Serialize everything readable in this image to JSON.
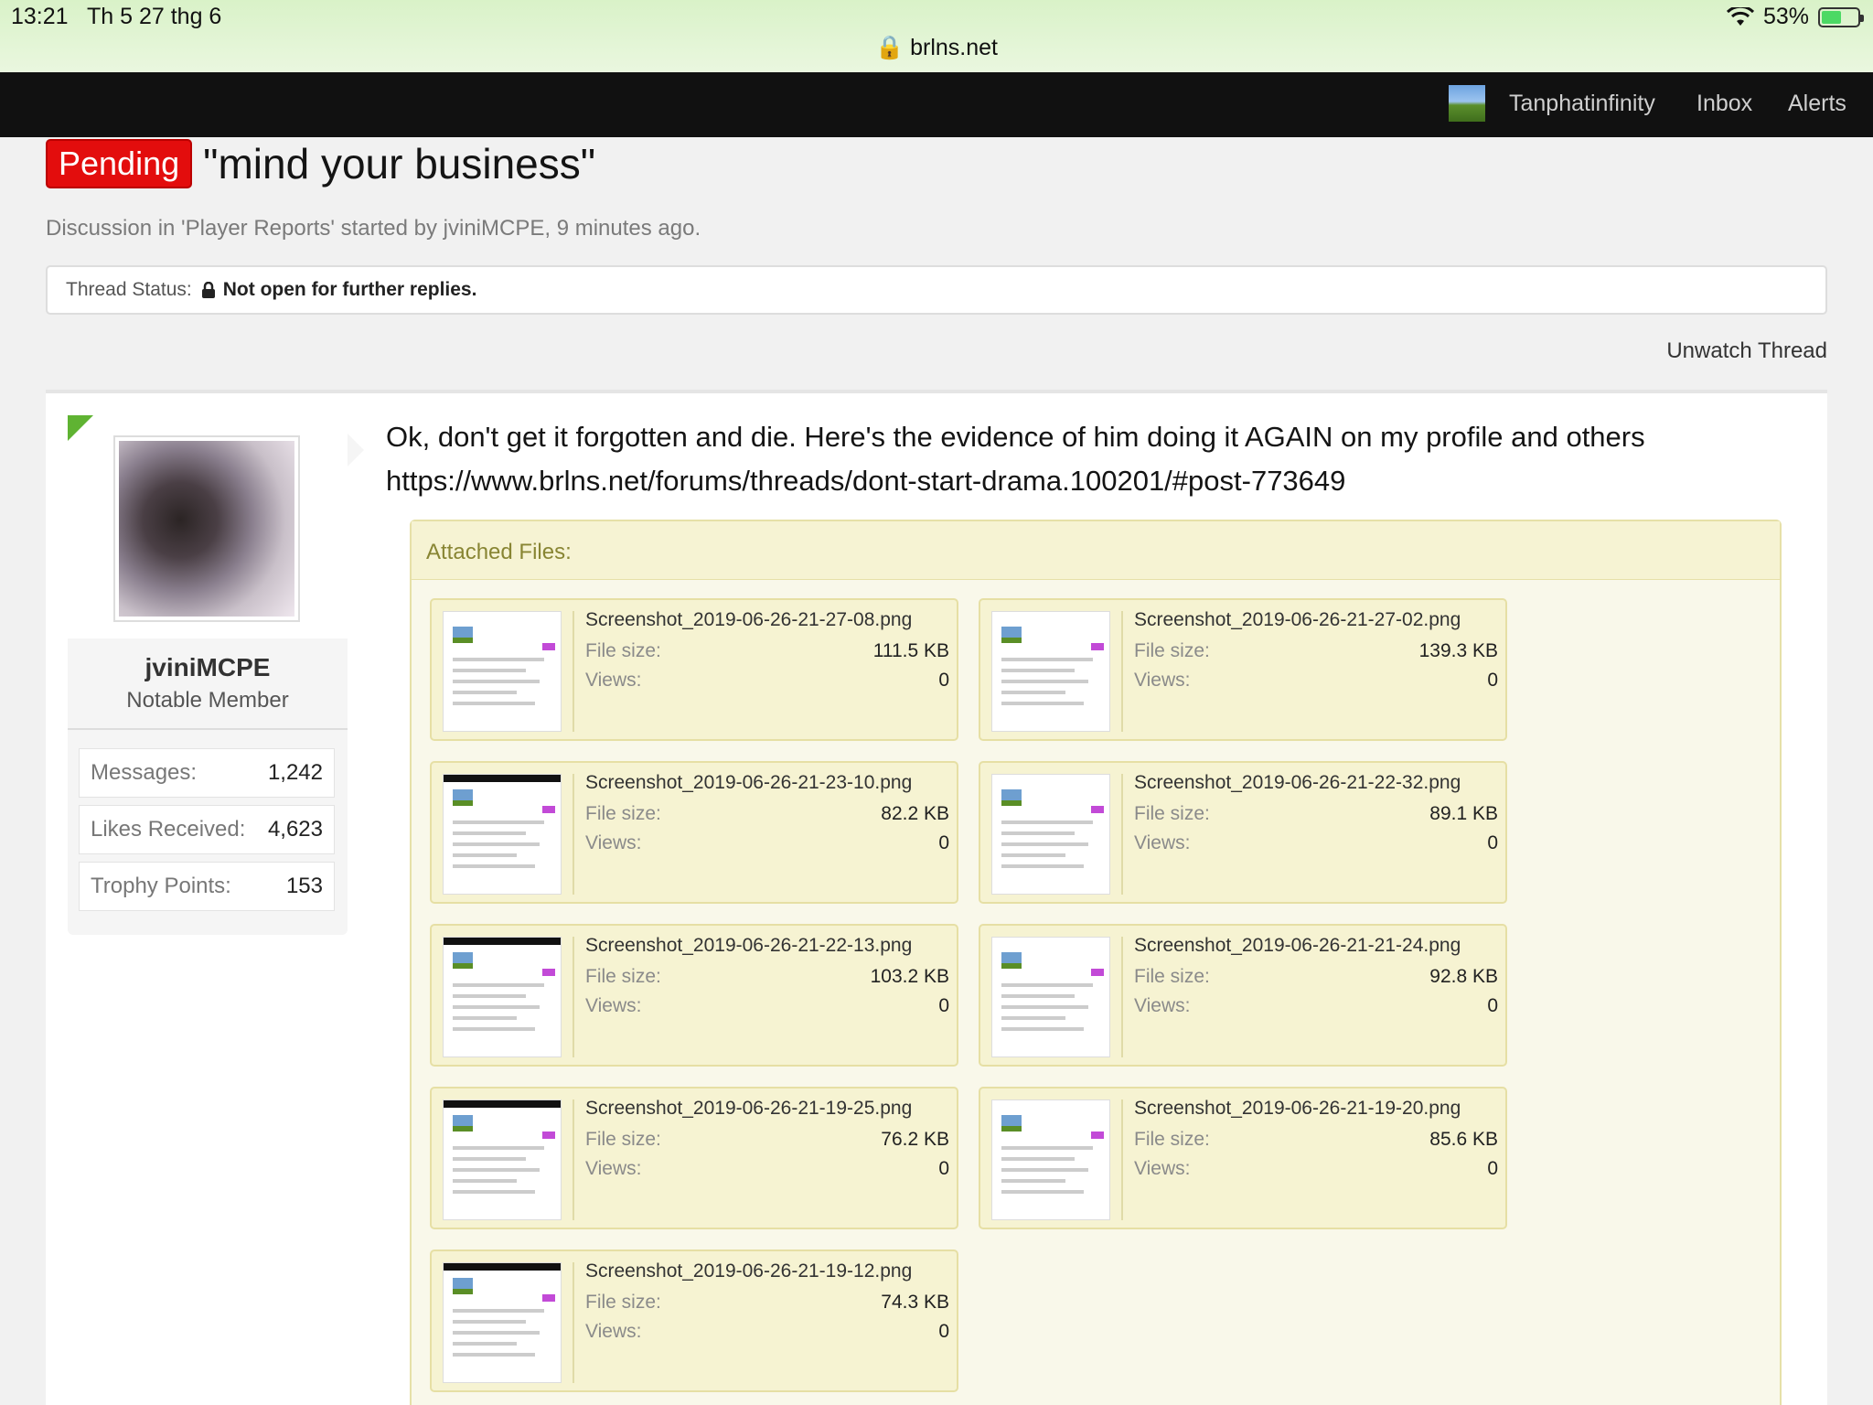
{
  "status_bar": {
    "time": "13:21",
    "date": "Th 5 27 thg 6",
    "battery": "53%",
    "url": "brlns.net"
  },
  "nav": {
    "username": "Tanphatinfinity",
    "inbox": "Inbox",
    "alerts": "Alerts"
  },
  "thread": {
    "prefix": "Pending",
    "title": "\"mind your business\"",
    "meta": "Discussion in 'Player Reports' started by jviniMCPE, 9 minutes ago.",
    "status_label": "Thread Status:",
    "status_value": "Not open for further replies.",
    "unwatch": "Unwatch Thread"
  },
  "user": {
    "name": "jviniMCPE",
    "title": "Notable Member",
    "stats": [
      {
        "label": "Messages:",
        "value": "1,242"
      },
      {
        "label": "Likes Received:",
        "value": "4,623"
      },
      {
        "label": "Trophy Points:",
        "value": "153"
      }
    ]
  },
  "post": {
    "line1": "Ok, don't get it forgotten and die. Here's the evidence of him doing it AGAIN on my profile and others",
    "line2": "https://www.brlns.net/forums/threads/dont-start-drama.100201/#post-773649"
  },
  "attachments": {
    "header": "Attached Files:",
    "size_label": "File size:",
    "views_label": "Views:",
    "files": [
      {
        "name": "Screenshot_2019-06-26-21-27-08.png",
        "size": "111.5 KB",
        "views": "0"
      },
      {
        "name": "Screenshot_2019-06-26-21-27-02.png",
        "size": "139.3 KB",
        "views": "0"
      },
      {
        "name": "Screenshot_2019-06-26-21-23-10.png",
        "size": "82.2 KB",
        "views": "0"
      },
      {
        "name": "Screenshot_2019-06-26-21-22-32.png",
        "size": "89.1 KB",
        "views": "0"
      },
      {
        "name": "Screenshot_2019-06-26-21-22-13.png",
        "size": "103.2 KB",
        "views": "0"
      },
      {
        "name": "Screenshot_2019-06-26-21-21-24.png",
        "size": "92.8 KB",
        "views": "0"
      },
      {
        "name": "Screenshot_2019-06-26-21-19-25.png",
        "size": "76.2 KB",
        "views": "0"
      },
      {
        "name": "Screenshot_2019-06-26-21-19-20.png",
        "size": "85.6 KB",
        "views": "0"
      },
      {
        "name": "Screenshot_2019-06-26-21-19-12.png",
        "size": "74.3 KB",
        "views": "0"
      }
    ]
  }
}
